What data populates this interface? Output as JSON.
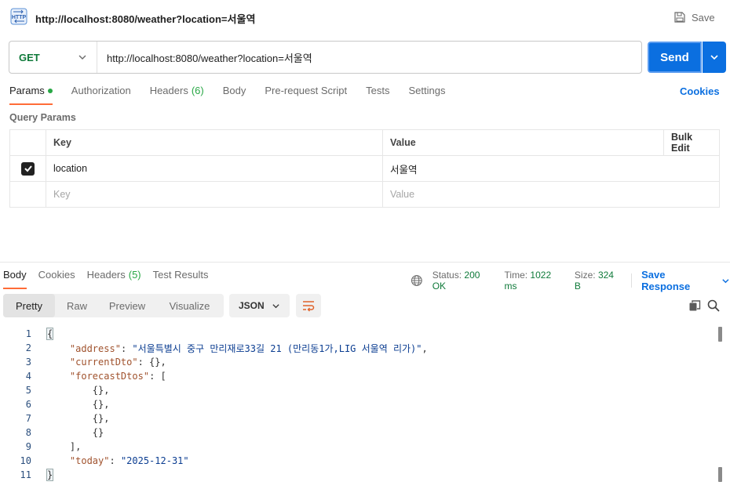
{
  "title": "http://localhost:8080/weather?location=서울역",
  "save_label": "Save",
  "request": {
    "method": "GET",
    "url": "http://localhost:8080/weather?location=서울역",
    "send_label": "Send"
  },
  "request_tabs": [
    {
      "label": "Params",
      "active": true
    },
    {
      "label": "Authorization"
    },
    {
      "label": "Headers",
      "count": "(6)"
    },
    {
      "label": "Body"
    },
    {
      "label": "Pre-request Script"
    },
    {
      "label": "Tests"
    },
    {
      "label": "Settings"
    }
  ],
  "cookies_label": "Cookies",
  "query_params": {
    "heading": "Query Params",
    "columns": {
      "key": "Key",
      "value": "Value",
      "bulk": "Bulk Edit"
    },
    "rows": [
      {
        "checked": true,
        "key": "location",
        "value": "서울역"
      }
    ],
    "placeholder": {
      "key": "Key",
      "value": "Value"
    }
  },
  "response_tabs": [
    {
      "label": "Body",
      "active": true
    },
    {
      "label": "Cookies"
    },
    {
      "label": "Headers",
      "count": "(5)"
    },
    {
      "label": "Test Results"
    }
  ],
  "response_status": {
    "status_label": "Status:",
    "status_value": "200 OK",
    "time_label": "Time:",
    "time_value": "1022 ms",
    "size_label": "Size:",
    "size_value": "324 B",
    "save_response_label": "Save Response"
  },
  "view_modes": [
    "Pretty",
    "Raw",
    "Preview",
    "Visualize"
  ],
  "format": "JSON",
  "code_lines": [
    {
      "n": "1",
      "html": "<span class='p bracket-hl'>{</span>"
    },
    {
      "n": "2",
      "html": "    <span class='k'>\"address\"</span><span class='p'>: </span><span class='s'>\"서울특별시 중구 만리재로33길 21 (만리동1가,LIG 서울역 리가)\"</span><span class='p'>,</span>"
    },
    {
      "n": "3",
      "html": "    <span class='k'>\"currentDto\"</span><span class='p'>: {},</span>"
    },
    {
      "n": "4",
      "html": "    <span class='k'>\"forecastDtos\"</span><span class='p'>: [</span>"
    },
    {
      "n": "5",
      "html": "        <span class='p'>{},</span>"
    },
    {
      "n": "6",
      "html": "        <span class='p'>{},</span>"
    },
    {
      "n": "7",
      "html": "        <span class='p'>{},</span>"
    },
    {
      "n": "8",
      "html": "        <span class='p'>{}</span>"
    },
    {
      "n": "9",
      "html": "    <span class='p'>],</span>"
    },
    {
      "n": "10",
      "html": "    <span class='k'>\"today\"</span><span class='p'>: </span><span class='s'>\"2025-12-31\"</span>"
    },
    {
      "n": "11",
      "html": "<span class='p bracket-hl'>}</span>"
    }
  ],
  "colors": {
    "accent": "#0b6fe0",
    "method": "#0f7a3a",
    "tab_indicator": "#ff6c37",
    "status_ok": "#0f7a3a"
  }
}
